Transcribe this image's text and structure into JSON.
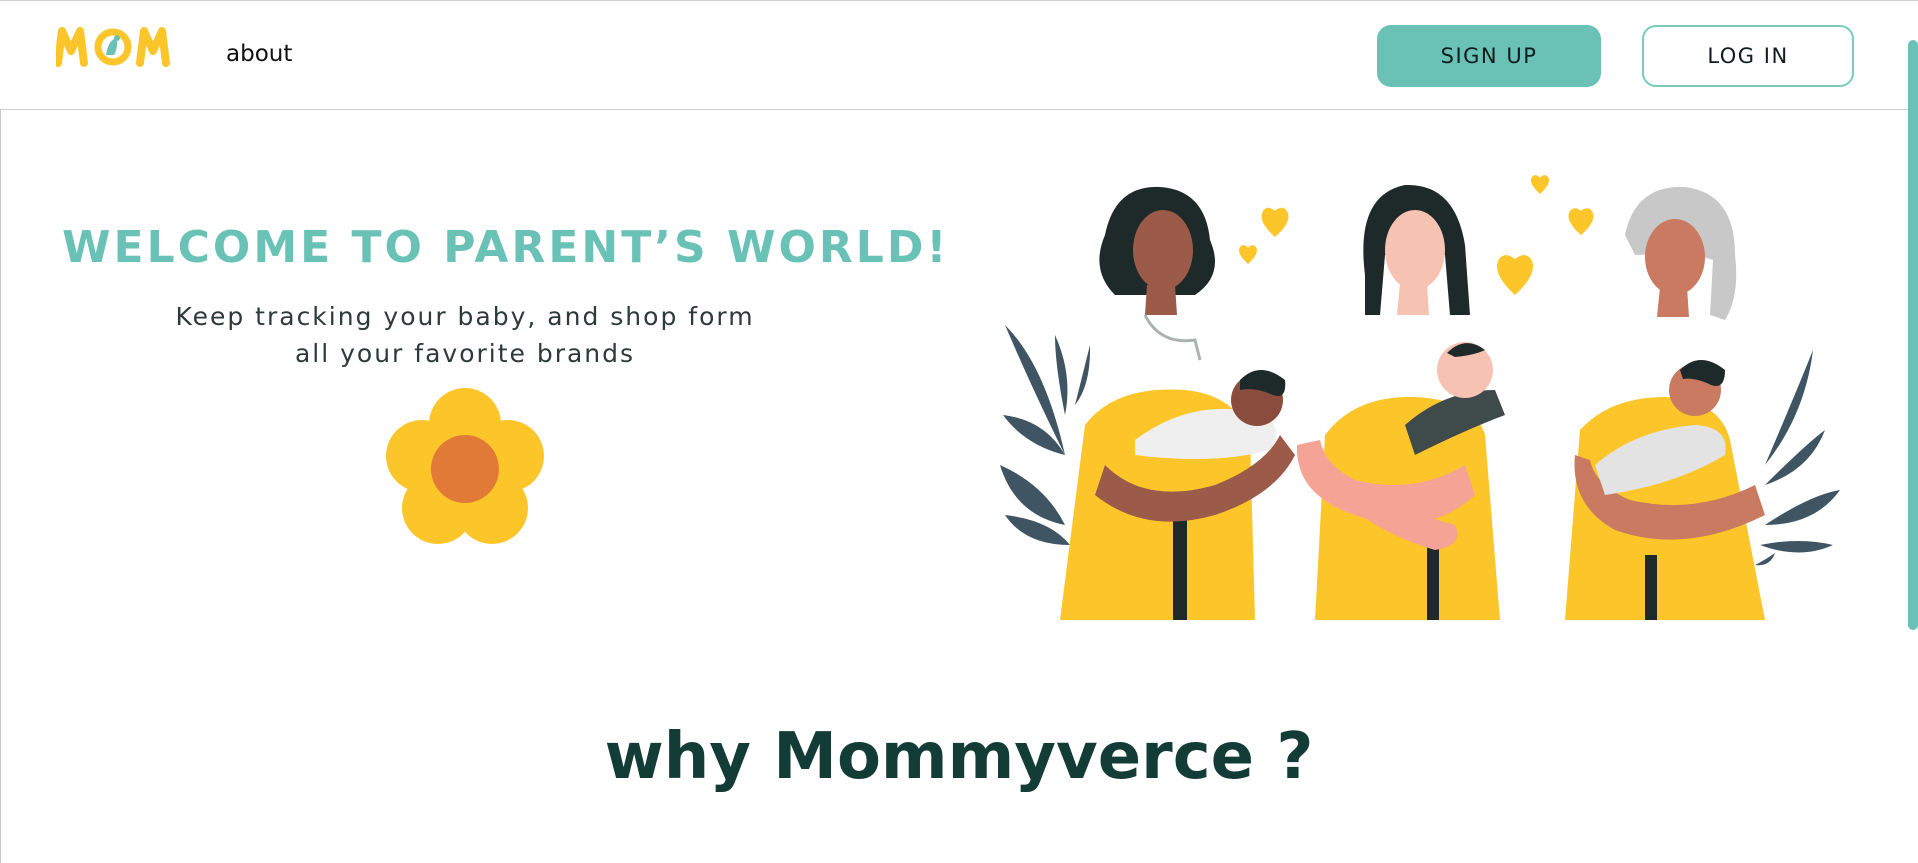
{
  "header": {
    "logo_text": "MOM",
    "nav": {
      "about_label": "about"
    },
    "signup_label": "SIGN UP",
    "login_label": "LOG IN"
  },
  "hero": {
    "title": "WELCOME TO PARENT’S WORLD!",
    "subtitle_line1": "Keep tracking your baby, and shop form",
    "subtitle_line2": "all your favorite brands"
  },
  "section": {
    "title": "why Mommyverce ?"
  },
  "colors": {
    "accent": "#6ac1b6",
    "yellow": "#fcc62b",
    "orange": "#e07a36",
    "dark_green": "#123c35",
    "foliage": "#3f5564"
  }
}
